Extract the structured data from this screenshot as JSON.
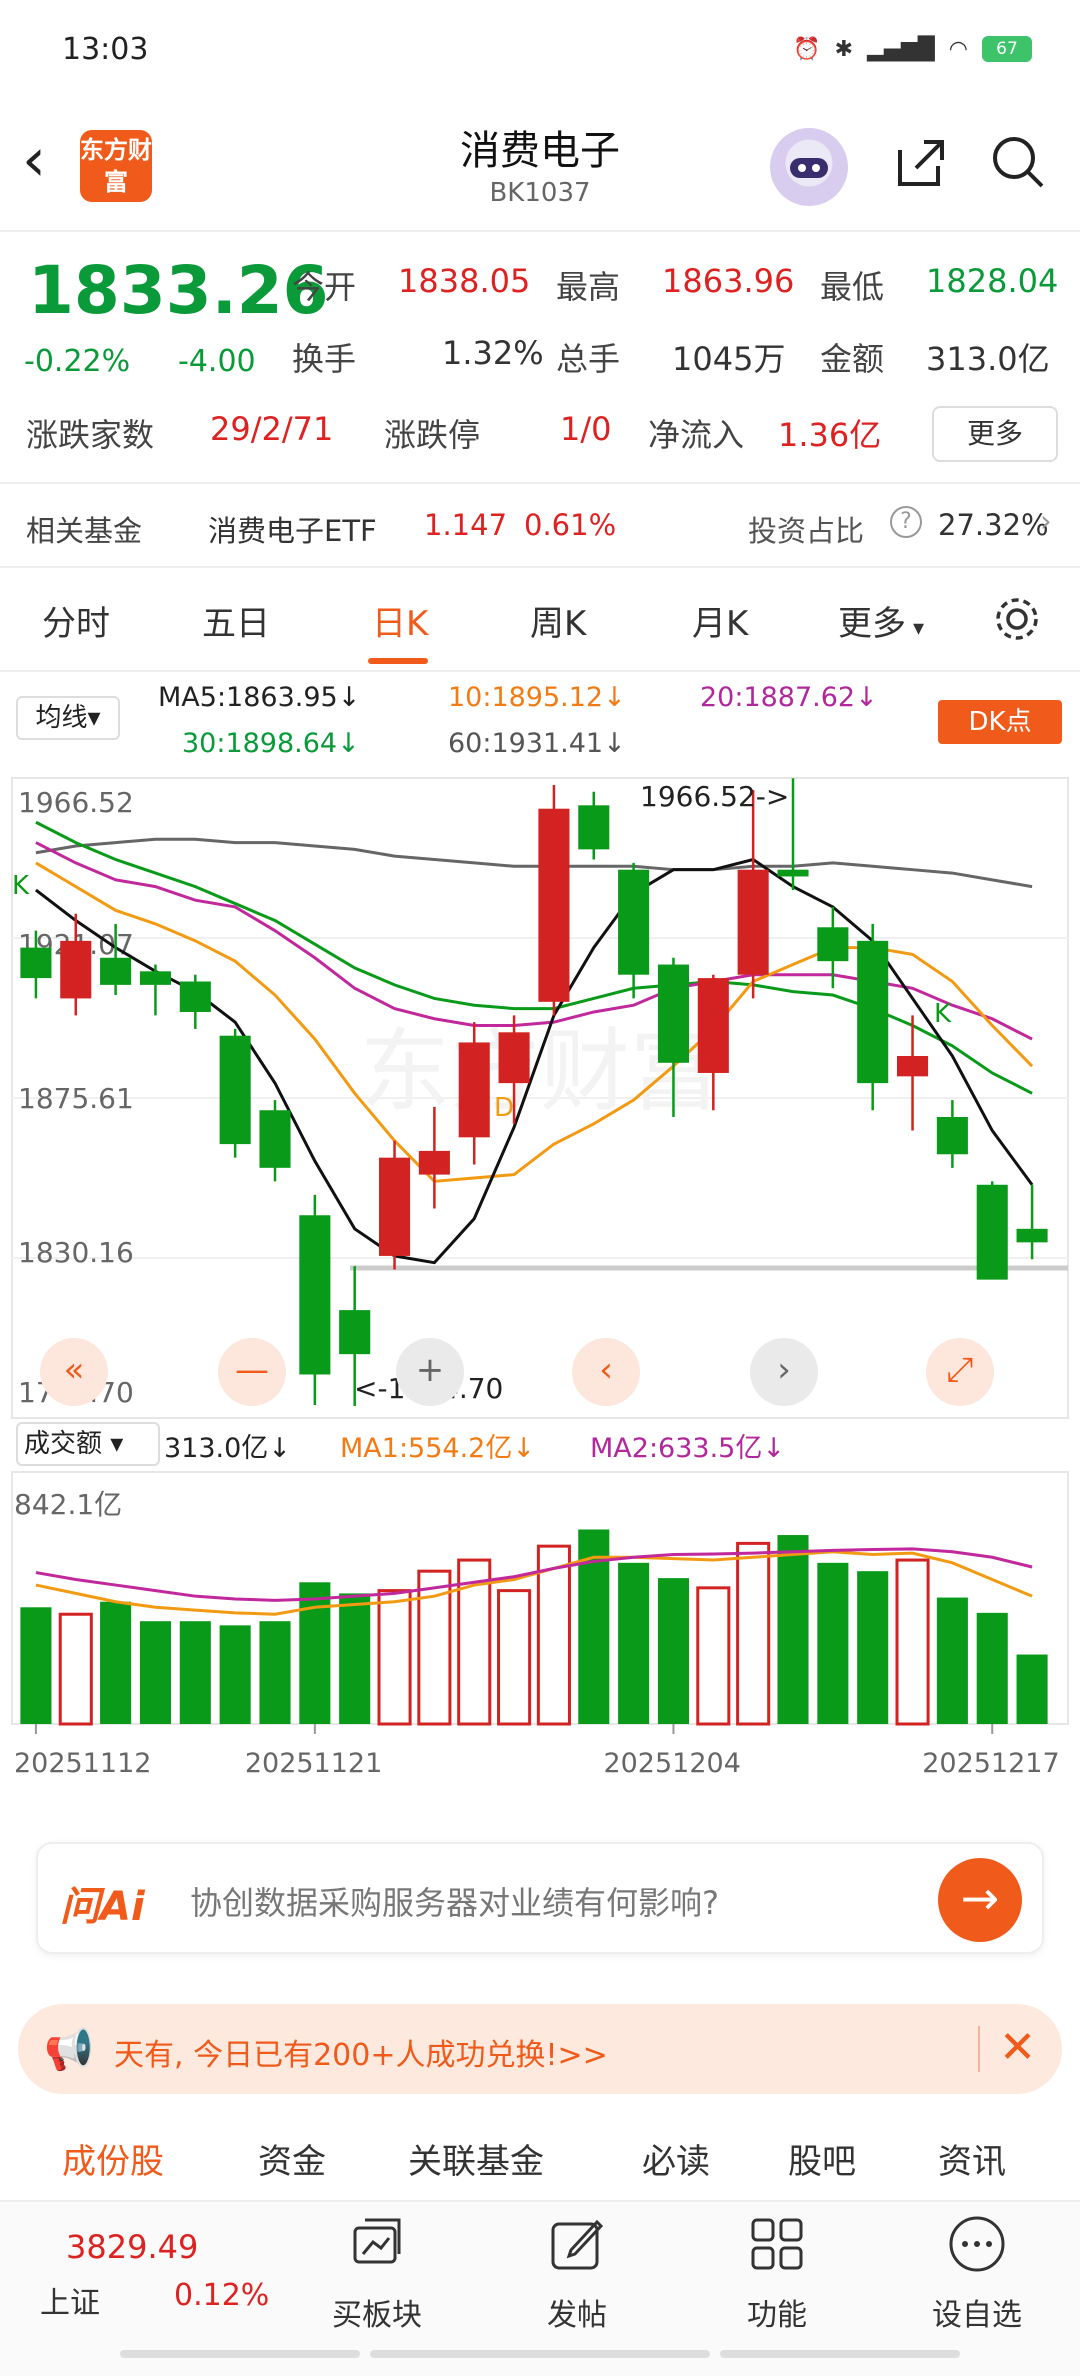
{
  "status": {
    "time": "13:03",
    "battery": "67"
  },
  "header": {
    "title": "消费电子",
    "code": "BK1037",
    "logo": "东方财富"
  },
  "quote": {
    "price": "1833.26",
    "change_pct": "-0.22%",
    "change": "-4.00",
    "open_label": "今开",
    "open": "1838.05",
    "high_label": "最高",
    "high": "1863.96",
    "low_label": "最低",
    "low": "1828.04",
    "turnover_label": "换手",
    "turnover": "1.32%",
    "volume_label": "总手",
    "volume": "1045万",
    "amount_label": "金额",
    "amount": "313.0亿",
    "breadth_label": "涨跌家数",
    "breadth": "29/2/71",
    "limit_label": "涨跌停",
    "limit": "1/0",
    "inflow_label": "净流入",
    "inflow": "1.36亿",
    "more": "更多"
  },
  "fund": {
    "label": "相关基金",
    "name": "消费电子ETF",
    "price": "1.147",
    "pct": "0.61%",
    "ratio_label": "投资占比",
    "ratio": "27.32%"
  },
  "tabs": [
    "分时",
    "五日",
    "日K",
    "周K",
    "月K",
    "更多"
  ],
  "ma": {
    "selector": "均线",
    "ma5": "MA5:1863.95↓",
    "ma10": "10:1895.12↓",
    "ma20": "20:1887.62↓",
    "ma30": "30:1898.64↓",
    "ma60": "60:1931.41↓",
    "dk": "DK点"
  },
  "vol_bar": {
    "selector": "成交额",
    "value": "313.0亿↓",
    "ma1": "MA1:554.2亿↓",
    "ma2": "MA2:633.5亿↓"
  },
  "chart_data": {
    "type": "candlestick",
    "price_labels": [
      "1966.52",
      "1921.07",
      "1875.61",
      "1830.16",
      "1784.70"
    ],
    "annot_high": "1966.52->",
    "annot_low": "<-1784.70",
    "mark_d": "D",
    "mark_k": "K",
    "ylim": [
      1784.7,
      1966.52
    ],
    "candles": [
      {
        "o": 1920,
        "h": 1925,
        "l": 1905,
        "c": 1911
      },
      {
        "o": 1905,
        "h": 1930,
        "l": 1900,
        "c": 1922
      },
      {
        "o": 1917,
        "h": 1927,
        "l": 1906,
        "c": 1909
      },
      {
        "o": 1913,
        "h": 1915,
        "l": 1900,
        "c": 1909
      },
      {
        "o": 1910,
        "h": 1912,
        "l": 1896,
        "c": 1901
      },
      {
        "o": 1894,
        "h": 1896,
        "l": 1858,
        "c": 1862
      },
      {
        "o": 1872,
        "h": 1875,
        "l": 1851,
        "c": 1855
      },
      {
        "o": 1841,
        "h": 1847,
        "l": 1785,
        "c": 1794
      },
      {
        "o": 1813,
        "h": 1826,
        "l": 1784.7,
        "c": 1800
      },
      {
        "o": 1829,
        "h": 1863,
        "l": 1825,
        "c": 1858
      },
      {
        "o": 1853,
        "h": 1873,
        "l": 1843,
        "c": 1860
      },
      {
        "o": 1864,
        "h": 1898,
        "l": 1856,
        "c": 1892
      },
      {
        "o": 1880,
        "h": 1900,
        "l": 1868,
        "c": 1895
      },
      {
        "o": 1904,
        "h": 1968,
        "l": 1900,
        "c": 1961
      },
      {
        "o": 1962,
        "h": 1966,
        "l": 1946,
        "c": 1949
      },
      {
        "o": 1943,
        "h": 1945,
        "l": 1905,
        "c": 1912
      },
      {
        "o": 1915,
        "h": 1917,
        "l": 1870,
        "c": 1886
      },
      {
        "o": 1883,
        "h": 1912,
        "l": 1872,
        "c": 1911
      },
      {
        "o": 1912,
        "h": 1966.5,
        "l": 1905,
        "c": 1943
      },
      {
        "o": 1943,
        "h": 1970,
        "l": 1937,
        "c": 1941
      },
      {
        "o": 1926,
        "h": 1932,
        "l": 1908,
        "c": 1916
      },
      {
        "o": 1922,
        "h": 1927,
        "l": 1872,
        "c": 1880
      },
      {
        "o": 1882,
        "h": 1900,
        "l": 1866,
        "c": 1888
      },
      {
        "o": 1870,
        "h": 1875,
        "l": 1855,
        "c": 1859
      },
      {
        "o": 1850,
        "h": 1851,
        "l": 1823,
        "c": 1822
      },
      {
        "o": 1837,
        "h": 1850,
        "l": 1828,
        "c": 1833
      }
    ],
    "ma5": [
      1937,
      1928,
      1920,
      1913,
      1907,
      1898,
      1880,
      1857,
      1837,
      1829,
      1827,
      1840,
      1867,
      1900,
      1920,
      1936,
      1943,
      1943,
      1946,
      1938,
      1932,
      1922,
      1905,
      1888,
      1866,
      1850
    ],
    "ma10": [
      1945,
      1938,
      1931,
      1927,
      1922,
      1916,
      1906,
      1893,
      1877,
      1863,
      1851,
      1852,
      1853,
      1862,
      1868,
      1875,
      1885,
      1896,
      1910,
      1915,
      1920,
      1920,
      1918,
      1910,
      1897,
      1885
    ],
    "ma20": [
      1951,
      1945,
      1940,
      1938,
      1934,
      1932,
      1925,
      1917,
      1908,
      1902,
      1899,
      1897,
      1897,
      1898,
      1901,
      1903,
      1908,
      1910,
      1912,
      1912,
      1912,
      1910,
      1908,
      1903,
      1899,
      1893
    ],
    "ma30": [
      1957,
      1951,
      1946,
      1942,
      1938,
      1933,
      1928,
      1921,
      1914,
      1909,
      1905,
      1903,
      1902,
      1902,
      1905,
      1908,
      1909,
      1910,
      1909,
      1907,
      1906,
      1902,
      1897,
      1891,
      1883,
      1877
    ],
    "ma60": [
      1948,
      1950,
      1951,
      1952,
      1952,
      1951,
      1951,
      1950,
      1949,
      1947,
      1946,
      1945,
      1944,
      1944,
      1944,
      1944,
      1943,
      1943,
      1944,
      1944,
      1945,
      1944,
      1943,
      1942,
      1940,
      1938
    ],
    "volume_label": "842.1亿",
    "volume": [
      420,
      395,
      440,
      370,
      370,
      355,
      370,
      510,
      470,
      480,
      550,
      590,
      480,
      640,
      700,
      580,
      525,
      490,
      650,
      680,
      580,
      550,
      590,
      455,
      400,
      250
    ],
    "vol_ma1": [
      500,
      470,
      440,
      420,
      410,
      400,
      395,
      420,
      430,
      440,
      460,
      500,
      520,
      560,
      600,
      600,
      595,
      590,
      600,
      610,
      620,
      610,
      615,
      580,
      520,
      460
    ],
    "vol_ma2": [
      545,
      520,
      500,
      480,
      460,
      450,
      445,
      450,
      460,
      470,
      490,
      510,
      530,
      560,
      585,
      600,
      610,
      612,
      615,
      620,
      625,
      628,
      630,
      620,
      600,
      565
    ],
    "dates": [
      "20251112",
      "20251121",
      "20251204",
      "20251217"
    ],
    "up_color": "#d22222",
    "down_color": "#0a9a1a"
  },
  "controls": [
    "«",
    "—",
    "+",
    "‹",
    "›",
    "⤢"
  ],
  "ask": {
    "brand": "问Ai",
    "question": "协创数据采购服务器对业绩有何影响?"
  },
  "banner": {
    "text": "天有, 今日已有200+人成功兑换!>>"
  },
  "bottom_tabs": [
    "成份股",
    "资金",
    "关联基金",
    "必读",
    "股吧",
    "资讯"
  ],
  "nav": {
    "index_name": "上证",
    "index_value": "3829.49",
    "index_pct": "0.12%",
    "items": [
      "买板块",
      "发帖",
      "功能",
      "设自选"
    ]
  }
}
